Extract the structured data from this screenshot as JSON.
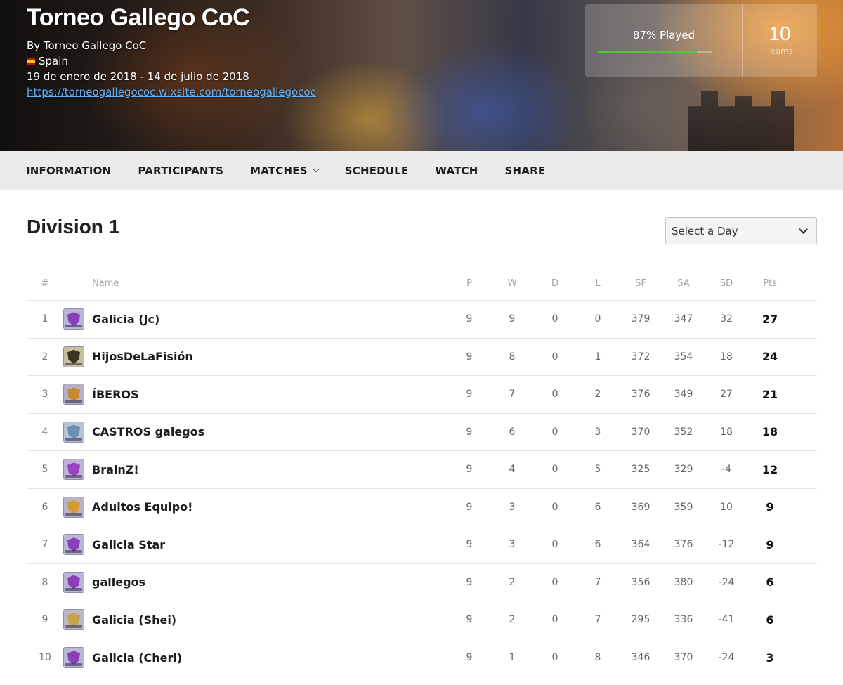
{
  "header": {
    "title": "Torneo Gallego CoC",
    "organizer": "By Torneo Gallego CoC",
    "country": "Spain",
    "dates": "19 de enero de 2018 - 14 de julio de 2018",
    "website": "https://torneogallegococ.wixsite.com/torneogallegococ",
    "played_label": "87% Played",
    "played_fraction": 0.87,
    "teams_count": "10",
    "teams_label": "Teams",
    "progress_color": "#56c23a"
  },
  "nav": {
    "items": [
      {
        "label": "INFORMATION"
      },
      {
        "label": "PARTICIPANTS"
      },
      {
        "label": "MATCHES",
        "icon": "chevron-down-icon"
      },
      {
        "label": "SCHEDULE"
      },
      {
        "label": "WATCH"
      },
      {
        "label": "SHARE"
      }
    ]
  },
  "division": {
    "title": "Division 1",
    "day_select_label": "Select a Day"
  },
  "table": {
    "headers": [
      "#",
      "Name",
      "P",
      "W",
      "D",
      "L",
      "SF",
      "SA",
      "SD",
      "Pts"
    ],
    "rows": [
      {
        "rank": "1",
        "name": "Galicia (Jc)",
        "p": "9",
        "w": "9",
        "d": "0",
        "l": "0",
        "sf": "379",
        "sa": "347",
        "sd": "32",
        "pts": "27",
        "logo_bg": "#b9b6d8",
        "logo_shield": "#8a3fb8"
      },
      {
        "rank": "2",
        "name": "HijosDeLaFisión",
        "p": "9",
        "w": "8",
        "d": "0",
        "l": "1",
        "sf": "372",
        "sa": "354",
        "sd": "18",
        "pts": "24",
        "logo_bg": "#c7bda0",
        "logo_shield": "#3b3420"
      },
      {
        "rank": "3",
        "name": "ÍBEROS",
        "p": "9",
        "w": "7",
        "d": "0",
        "l": "2",
        "sf": "376",
        "sa": "349",
        "sd": "27",
        "pts": "21",
        "logo_bg": "#b4b0c8",
        "logo_shield": "#c98a2c"
      },
      {
        "rank": "4",
        "name": "CASTROS galegos",
        "p": "9",
        "w": "6",
        "d": "0",
        "l": "3",
        "sf": "370",
        "sa": "352",
        "sd": "18",
        "pts": "18",
        "logo_bg": "#b8c2d4",
        "logo_shield": "#6d8eb3"
      },
      {
        "rank": "5",
        "name": "BrainZ!",
        "p": "9",
        "w": "4",
        "d": "0",
        "l": "5",
        "sf": "325",
        "sa": "329",
        "sd": "-4",
        "pts": "12",
        "logo_bg": "#bcb3d6",
        "logo_shield": "#9a43c0"
      },
      {
        "rank": "6",
        "name": "Adultos Equipo!",
        "p": "9",
        "w": "3",
        "d": "0",
        "l": "6",
        "sf": "369",
        "sa": "359",
        "sd": "10",
        "pts": "9",
        "logo_bg": "#b7b3cb",
        "logo_shield": "#d69b2f"
      },
      {
        "rank": "7",
        "name": "Galicia Star",
        "p": "9",
        "w": "3",
        "d": "0",
        "l": "6",
        "sf": "364",
        "sa": "376",
        "sd": "-12",
        "pts": "9",
        "logo_bg": "#b9b6d8",
        "logo_shield": "#8a3fb8"
      },
      {
        "rank": "8",
        "name": "gallegos",
        "p": "9",
        "w": "2",
        "d": "0",
        "l": "7",
        "sf": "356",
        "sa": "380",
        "sd": "-24",
        "pts": "6",
        "logo_bg": "#b9b6d8",
        "logo_shield": "#8a3fb8"
      },
      {
        "rank": "9",
        "name": "Galicia (Shei)",
        "p": "9",
        "w": "2",
        "d": "0",
        "l": "7",
        "sf": "295",
        "sa": "336",
        "sd": "-41",
        "pts": "6",
        "logo_bg": "#bdb8c6",
        "logo_shield": "#c9a347"
      },
      {
        "rank": "10",
        "name": "Galicia (Cheri)",
        "p": "9",
        "w": "1",
        "d": "0",
        "l": "8",
        "sf": "346",
        "sa": "370",
        "sd": "-24",
        "pts": "3",
        "logo_bg": "#b9b6d8",
        "logo_shield": "#8a3fb8"
      }
    ]
  }
}
